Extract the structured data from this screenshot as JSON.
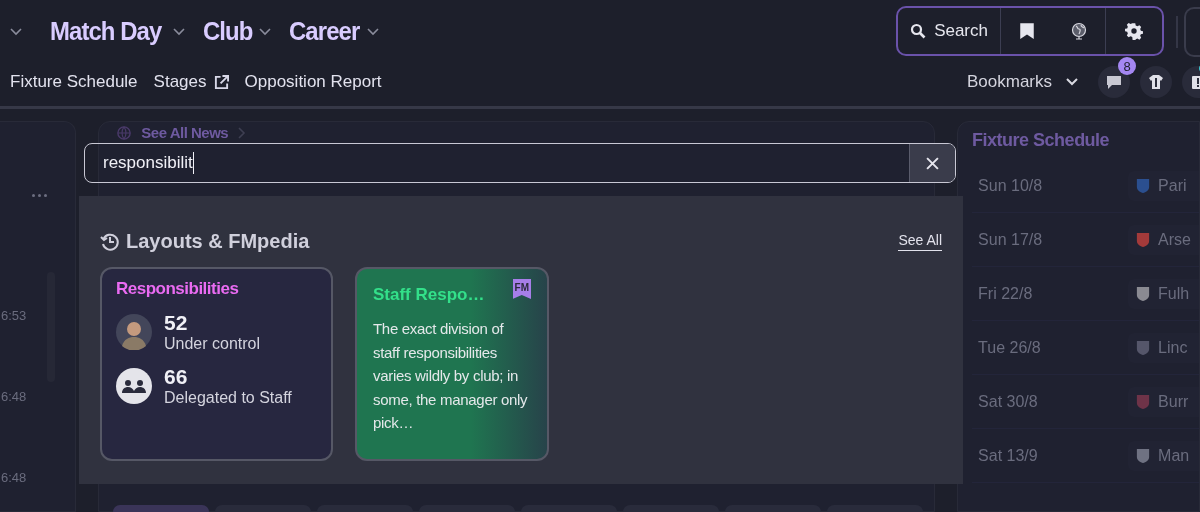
{
  "nav": {
    "items": [
      {
        "label": "Match Day"
      },
      {
        "label": "Club"
      },
      {
        "label": "Career"
      }
    ]
  },
  "toolbar": {
    "search_label": "Search"
  },
  "subnav": {
    "links": [
      {
        "label": "Fixture Schedule",
        "external": false
      },
      {
        "label": "Stages",
        "external": true
      },
      {
        "label": "Opposition Report",
        "external": false
      }
    ]
  },
  "bookmarks": {
    "label": "Bookmarks"
  },
  "messages": {
    "count": "8"
  },
  "left_panel": {
    "times": [
      "6:53",
      "6:48",
      "6:48"
    ]
  },
  "news": {
    "link": "See All News"
  },
  "fixtures": {
    "title": "Fixture Schedule",
    "rows": [
      {
        "date": "Sun 10/8",
        "team": "Pari",
        "color": "#2b4f8f"
      },
      {
        "date": "Sun 17/8",
        "team": "Arse",
        "color": "#a33a3a"
      },
      {
        "date": "Fri 22/8",
        "team": "Fulh",
        "color": "#8a8a92"
      },
      {
        "date": "Tue 26/8",
        "team": "Linc",
        "color": "#55566a"
      },
      {
        "date": "Sat 30/8",
        "team": "Burr",
        "color": "#6e3348"
      },
      {
        "date": "Sat 13/9",
        "team": "Man",
        "color": "#6f7282"
      }
    ]
  },
  "search": {
    "value": "responsibilit"
  },
  "results": {
    "section": "Layouts & FMpedia",
    "see_all": "See All",
    "cards": [
      {
        "kind": "layout",
        "title": "Responsibilities",
        "stats": [
          {
            "kind": "manager",
            "value": "52",
            "label": "Under control"
          },
          {
            "kind": "staff",
            "value": "66",
            "label": "Delegated to Staff"
          }
        ]
      },
      {
        "kind": "article",
        "title": "Staff Respo…",
        "badge": "FM",
        "body": "The exact division of staff responsibilities varies wildly by club; in some, the manager only pick…"
      }
    ]
  }
}
